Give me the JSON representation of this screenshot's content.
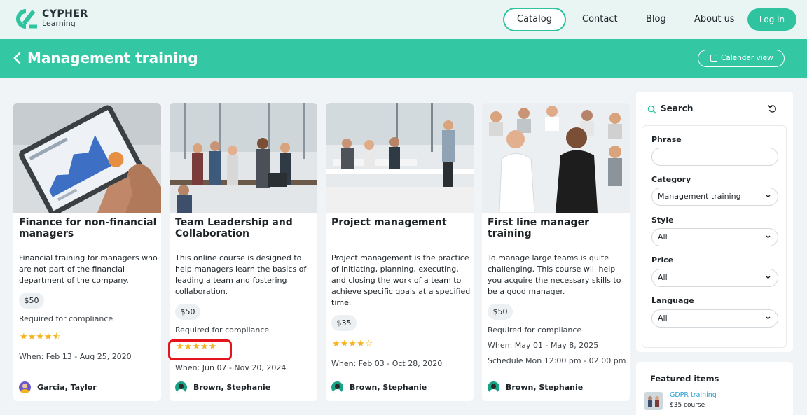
{
  "brand": {
    "name_line1": "CYPHER",
    "name_line2": "Learning",
    "accent": "#2fc3a0"
  },
  "nav": {
    "catalog": "Catalog",
    "contact": "Contact",
    "blog": "Blog",
    "about": "About us",
    "login": "Log in"
  },
  "header": {
    "title": "Management training",
    "calendar_button": "Calendar view",
    "background": "#33c7a4"
  },
  "courses": [
    {
      "title": "Finance for non-financial managers",
      "description": "Financial training for managers who are not part of the financial department of the company.",
      "price": "$50",
      "compliance": "Required for compliance",
      "stars": "★★★★⯪",
      "rating": 4.5,
      "when": "When: Feb 13 - Aug 25, 2020",
      "schedule": "",
      "author": "Garcia, Taylor"
    },
    {
      "title": "Team Leadership and Collaboration",
      "description": "This online course is designed to help managers learn the basics of leading a team and fostering collaboration.",
      "price": "$50",
      "compliance": "Required for compliance",
      "stars": "★★★★★",
      "rating": 5,
      "when": "When: Jun 07 - Nov 20, 2024",
      "schedule": "",
      "author": "Brown, Stephanie"
    },
    {
      "title": "Project management",
      "description": "Project management is the practice of initiating, planning, executing, and closing the work of a team to achieve specific goals at a specified time.",
      "price": "$35",
      "compliance": "",
      "stars": "★★★★☆",
      "rating": 4,
      "when": "When: Feb 03 - Oct 28, 2020",
      "schedule": "",
      "author": "Brown, Stephanie"
    },
    {
      "title": "First line manager training",
      "description": "To manage large teams is quite challenging. This course will help you acquire the necessary skills to be a good manager.",
      "price": "$50",
      "compliance": "Required for compliance",
      "stars": "",
      "rating": null,
      "when": "When: May 01 - May 8, 2025",
      "schedule": "Schedule Mon 12:00 pm - 02:00 pm",
      "author": "Brown, Stephanie"
    }
  ],
  "sidebar": {
    "search_title": "Search",
    "phrase_label": "Phrase",
    "phrase_value": "",
    "category_label": "Category",
    "category_value": "Management training",
    "style_label": "Style",
    "style_value": "All",
    "price_label": "Price",
    "price_value": "All",
    "language_label": "Language",
    "language_value": "All"
  },
  "featured": {
    "title": "Featured items",
    "items": [
      {
        "name": "GDPR training",
        "subtitle": "$35 course"
      }
    ]
  }
}
